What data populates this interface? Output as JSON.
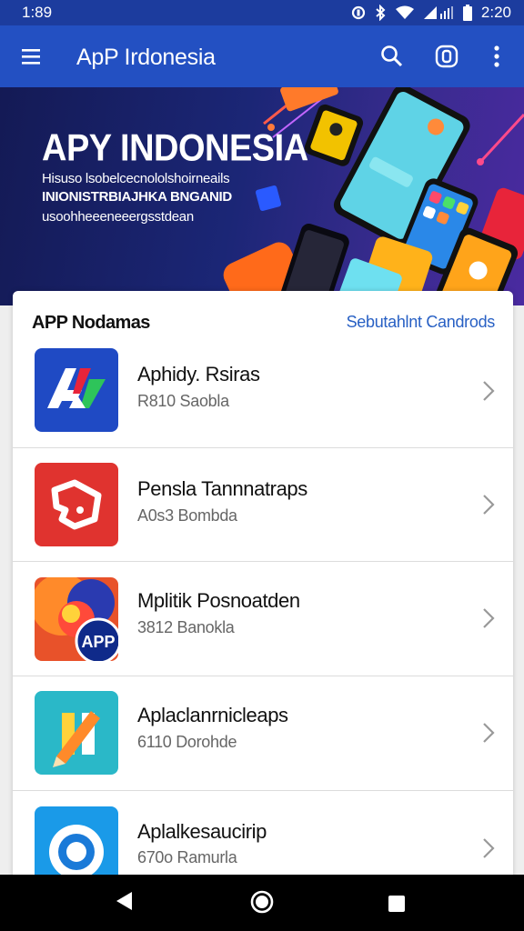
{
  "status_bar": {
    "time_left": "1:89",
    "time_right": "2:20",
    "icons": [
      "sync-icon",
      "bluetooth-icon",
      "wifi-icon",
      "signal-icon",
      "battery-icon"
    ]
  },
  "app_bar": {
    "title": "ApP Irdonesia",
    "icons": [
      "menu-icon",
      "search-icon",
      "store-icon",
      "more-vert-icon"
    ],
    "color": "#2350c2"
  },
  "hero": {
    "title": "APY INDONESIA",
    "line1": "Hisuso lsobelcecnololshoirneails",
    "line2": "INIONISTRBIAJHKA BNGANID",
    "line3": "usoohheeeneeergsstdean"
  },
  "section": {
    "title": "APP Nodamas",
    "link": "Sebutahlnt Candrods",
    "link_color": "#2860c4"
  },
  "apps": [
    {
      "name": "Aphidy. Rsiras",
      "meta": "R810 Saobla",
      "icon": "letter-a-icon"
    },
    {
      "name": "Pensla Tannnatraps",
      "meta": "A0s3 Bombda",
      "icon": "red-tag-icon"
    },
    {
      "name": "Mplitik Posnoatden",
      "meta": "3812 Banokla",
      "icon": "swirl-app-icon"
    },
    {
      "name": "Aplaclanrnicleaps",
      "meta": "6110 Dorohde",
      "icon": "pencil-icon"
    },
    {
      "name": "Aplalkesaucirip",
      "meta": "670o Ramurla",
      "icon": "ring-icon"
    }
  ],
  "nav_bar": {
    "buttons": [
      "back-icon",
      "home-icon",
      "recents-icon"
    ]
  }
}
